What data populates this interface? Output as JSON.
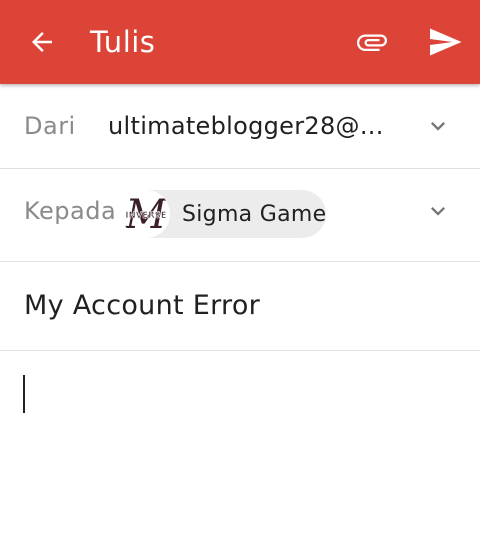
{
  "colors": {
    "accent": "#db4437",
    "appbar_text": "#ffffff",
    "label": "#8a8a8a",
    "text": "#212121",
    "chip_bg": "#ececec"
  },
  "appbar": {
    "title": "Tulis",
    "back_icon": "arrow-back-icon",
    "attach_icon": "paperclip-icon",
    "send_icon": "send-icon"
  },
  "from": {
    "label": "Dari",
    "value": "ultimateblogger28@..."
  },
  "to": {
    "label": "Kepada",
    "recipient": {
      "name": "Sigma Game",
      "avatar_text": "INVERSE",
      "avatar_letter": "M"
    }
  },
  "subject": {
    "value": "My Account Error"
  },
  "body": {
    "value": ""
  }
}
